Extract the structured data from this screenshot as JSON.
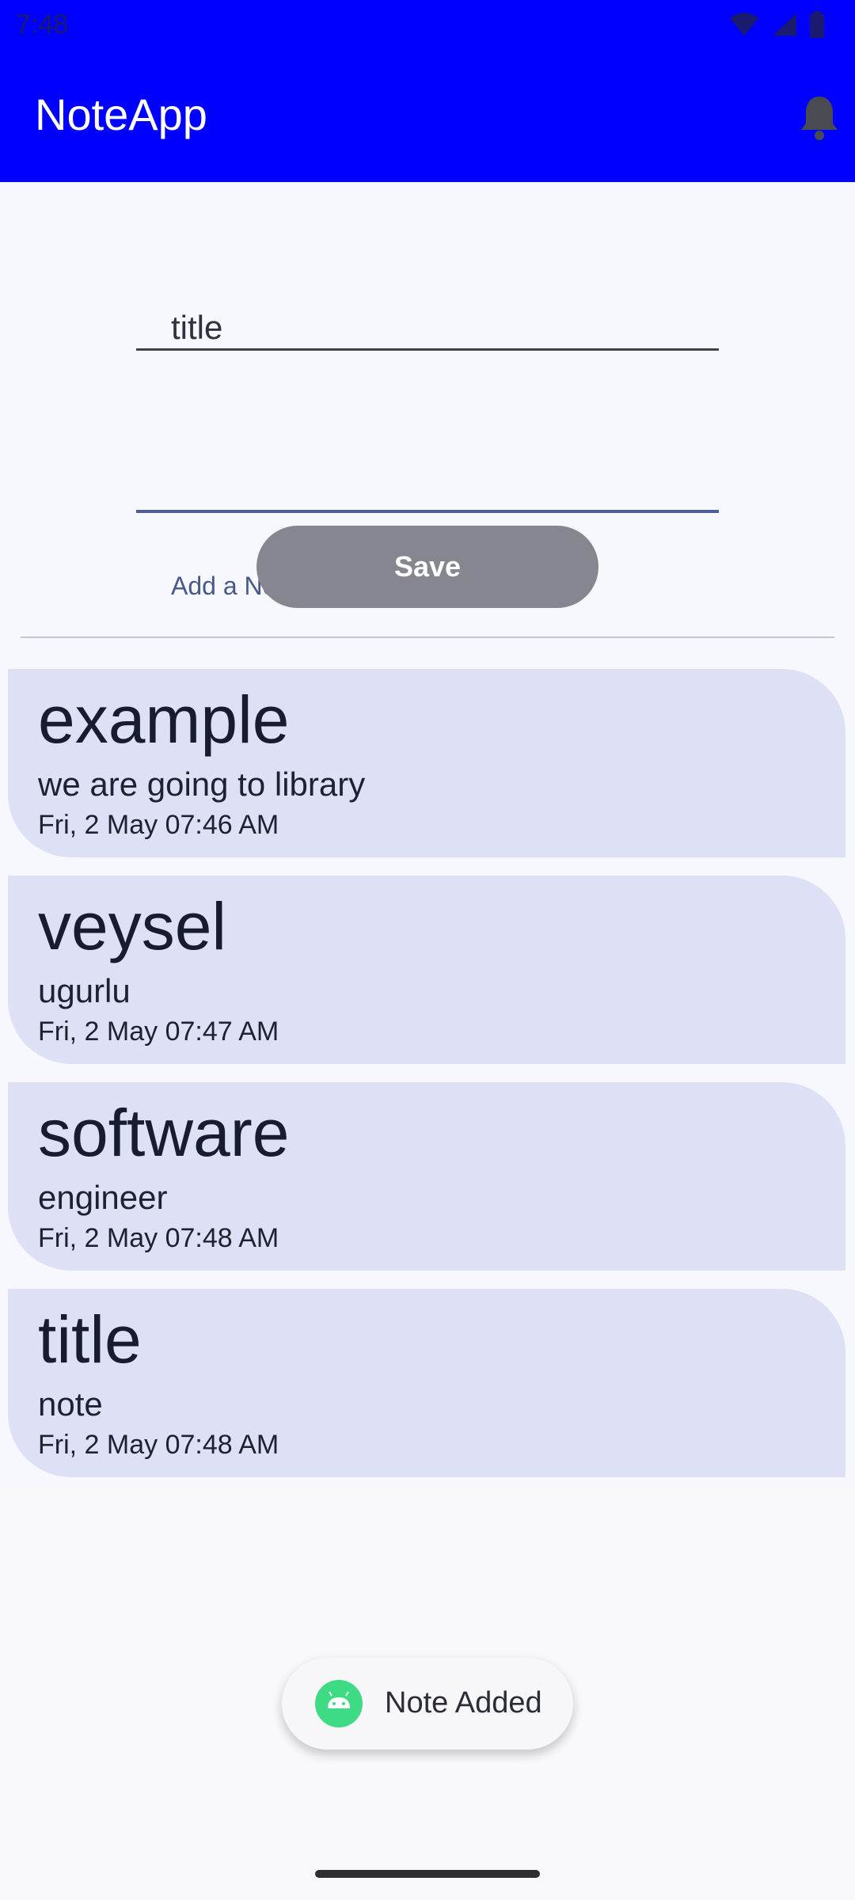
{
  "status_bar": {
    "time": "7:48"
  },
  "app_bar": {
    "title": "NoteApp",
    "action_icon": "bell-icon"
  },
  "form": {
    "title_value": "title",
    "note_label": "Add a Note",
    "save_label": "Save"
  },
  "notes": [
    {
      "title": "example",
      "body": "we are going to library",
      "date": "Fri, 2 May 07:46 AM"
    },
    {
      "title": "veysel",
      "body": "ugurlu",
      "date": "Fri, 2 May 07:47 AM"
    },
    {
      "title": "software",
      "body": "engineer",
      "date": "Fri, 2 May 07:48 AM"
    },
    {
      "title": "title",
      "body": "note",
      "date": "Fri, 2 May 07:48 AM"
    }
  ],
  "toast": {
    "text": "Note Added",
    "icon": "android-icon"
  },
  "colors": {
    "app_bar": "#0000ff",
    "card": "#dee1f6",
    "save_button": "#858690"
  }
}
